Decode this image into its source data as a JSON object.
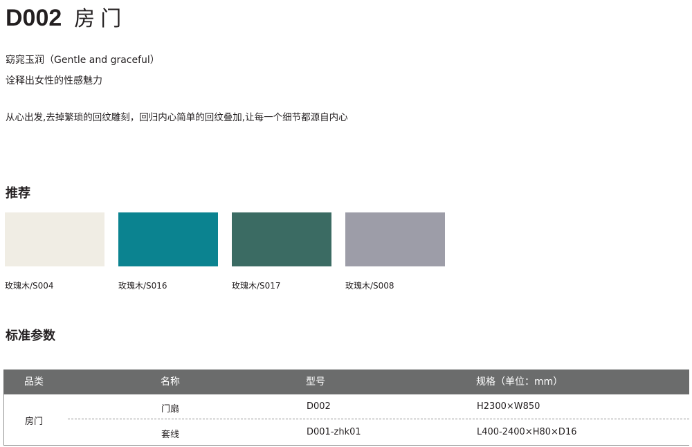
{
  "product": {
    "code": "D002",
    "name": "房门"
  },
  "tagline": {
    "line1": "窈窕玉润（Gentle and graceful）",
    "line2": "诠释出女性的性感魅力"
  },
  "description": "从心出发,去掉繁琐的回纹雕刻，回归内心简单的回纹叠加,让每一个细节都源自内心",
  "recommend": {
    "title": "推荐",
    "swatches": [
      {
        "label": "玫瑰木/S004",
        "color": "#f0ede4"
      },
      {
        "label": "玫瑰木/S016",
        "color": "#0b8390"
      },
      {
        "label": "玫瑰木/S017",
        "color": "#3b6b63"
      },
      {
        "label": "玫瑰木/S008",
        "color": "#9d9da8"
      }
    ]
  },
  "specs": {
    "title": "标准参数",
    "headers": [
      "品类",
      "名称",
      "型号",
      "规格（单位：mm）"
    ],
    "category": "房门",
    "rows": [
      {
        "name": "门扇",
        "model": "D002",
        "size": "H2300×W850"
      },
      {
        "name": "套线",
        "model": "D001-zhk01",
        "size": "L400-2400×H80×D16"
      }
    ]
  },
  "colors": {
    "header_bg": "#6b6c6c",
    "text": "#231f20"
  }
}
